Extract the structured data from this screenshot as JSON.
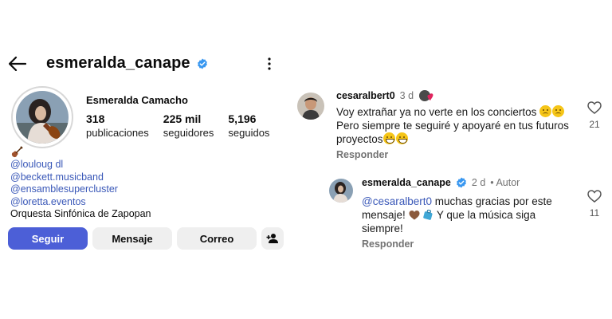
{
  "profile": {
    "username": "esmeralda_canape",
    "full_name": "Esmeralda Camacho",
    "stats": [
      {
        "value": "318",
        "label": "publicaciones"
      },
      {
        "value": "225 mil",
        "label": "seguidores"
      },
      {
        "value": "5,196",
        "label": "seguidos"
      }
    ],
    "bio_links": [
      "@louloug dl",
      "@beckett.musicband",
      "@ensamblesupercluster",
      "@loretta.eventos"
    ],
    "bio_text": "Orquesta Sinfónica de Zapopan",
    "buttons": {
      "follow": "Seguir",
      "message": "Mensaje",
      "email": "Correo"
    },
    "verified_color": "#3897f0",
    "follow_color": "#4c5fd7"
  },
  "comments": [
    {
      "user": "cesaralbert0",
      "time": "3 d",
      "text_before": "Voy extrañar ya no verte en los conciertos",
      "text_after": "Pero siempre te seguiré y apoyaré en tus futuros proyectos",
      "reply_label": "Responder",
      "likes": "21"
    },
    {
      "user": "esmeralda_canape",
      "time": "2 d",
      "author_tag": "• Autor",
      "mention": "@cesaralbert0",
      "text_main": " muchas gracias por este mensaje!",
      "text_end": " Y que la música siga siempre!",
      "reply_label": "Responder",
      "likes": "11"
    }
  ]
}
